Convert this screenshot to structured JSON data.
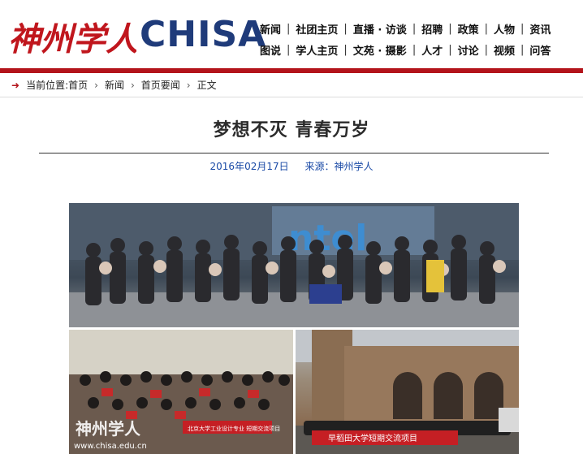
{
  "header": {
    "logo_cn": "神州学人",
    "logo_en": "CHISA",
    "nav_row1": [
      "新闻",
      "社团主页",
      "直播 · 访谈",
      "招聘",
      "政策",
      "人物",
      "资讯"
    ],
    "nav_row2": [
      "图说",
      "学人主页",
      "文苑 · 摄影",
      "人才",
      "讨论",
      "视频",
      "问答"
    ]
  },
  "breadcrumb": {
    "prefix": "当前位置:",
    "items": [
      "首页",
      "新闻",
      "首页要闻",
      "正文"
    ]
  },
  "article": {
    "title": "梦想不灭  青春万岁",
    "date": "2016年02月17日",
    "source": "来源：神州学人"
  },
  "photos": {
    "watermark_url": "www.chisa.edu.cn",
    "watermark_logo": "神州学人",
    "banner_left": "北京大学工业设计专业 短期交流项目",
    "banner_right": "早稻田大学短期交流项目"
  },
  "colors": {
    "brand_red": "#b3141b",
    "brand_blue": "#1f3b7a",
    "meta_blue": "#1a4aa6"
  }
}
